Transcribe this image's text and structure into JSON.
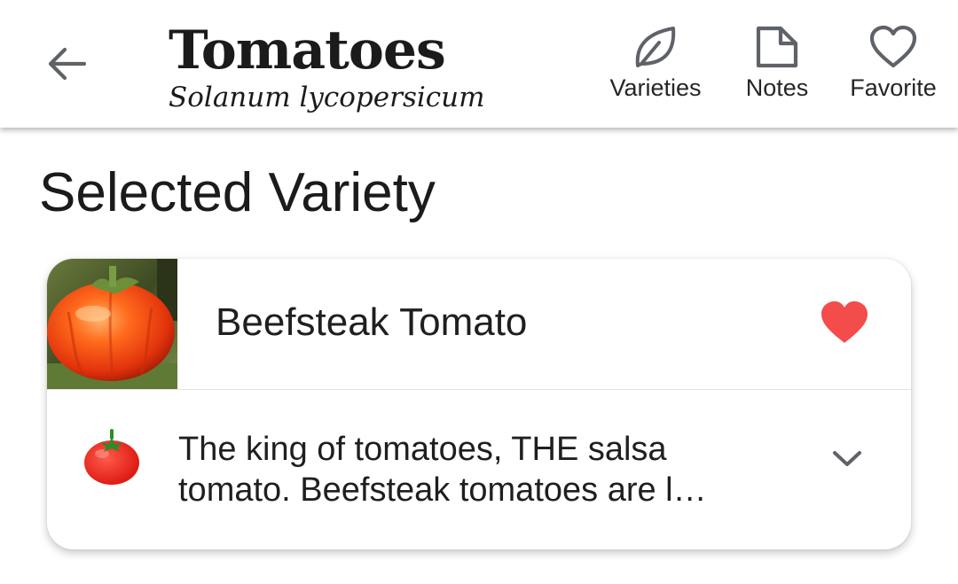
{
  "app_bar": {
    "back_icon": "arrow-left-icon",
    "title": "Tomatoes",
    "subtitle": "Solanum lycopersicum",
    "actions": [
      {
        "label": "Varieties",
        "icon": "leaf-icon"
      },
      {
        "label": "Notes",
        "icon": "note-icon"
      },
      {
        "label": "Favorite",
        "icon": "heart-outline-icon"
      }
    ]
  },
  "section": {
    "title": "Selected Variety"
  },
  "variety_card": {
    "name": "Beefsteak Tomato",
    "thumbnail": "tomato-photo",
    "favorite_icon": "heart-filled-icon",
    "favorited": true,
    "description_icon": "tomato-emoji-icon",
    "description": "The king of tomatoes, THE salsa tomato. Beefsteak tomatoes are l…",
    "expand_icon": "chevron-down-icon"
  },
  "colors": {
    "favorite_red": "#f44b4b",
    "icon_gray": "#5f6368",
    "text": "#1f1f1f"
  }
}
